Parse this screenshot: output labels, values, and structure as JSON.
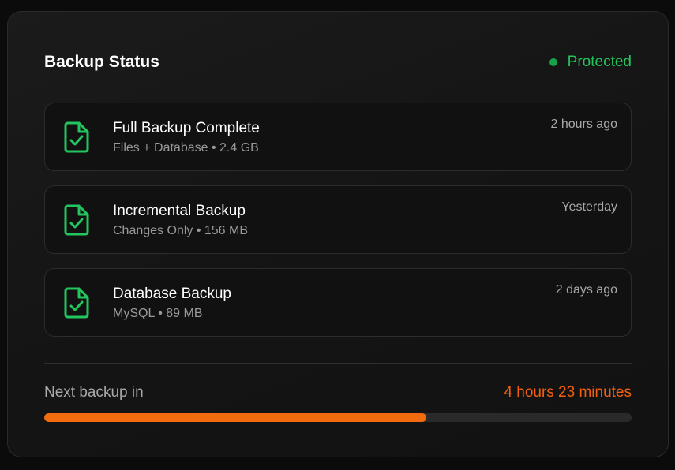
{
  "header": {
    "title": "Backup Status",
    "status_label": "Protected",
    "status_color": "#22c55e"
  },
  "backups": [
    {
      "title": "Full Backup Complete",
      "details": "Files + Database • 2.4 GB",
      "time": "2 hours ago",
      "icon": "file-check-icon"
    },
    {
      "title": "Incremental Backup",
      "details": "Changes Only • 156 MB",
      "time": "Yesterday",
      "icon": "file-check-icon"
    },
    {
      "title": "Database Backup",
      "details": "MySQL • 89 MB",
      "time": "2 days ago",
      "icon": "file-check-icon"
    }
  ],
  "next_backup": {
    "label": "Next backup in",
    "value": "4 hours 23 minutes",
    "progress_percent": 65,
    "accent_color": "#f26b0f"
  }
}
